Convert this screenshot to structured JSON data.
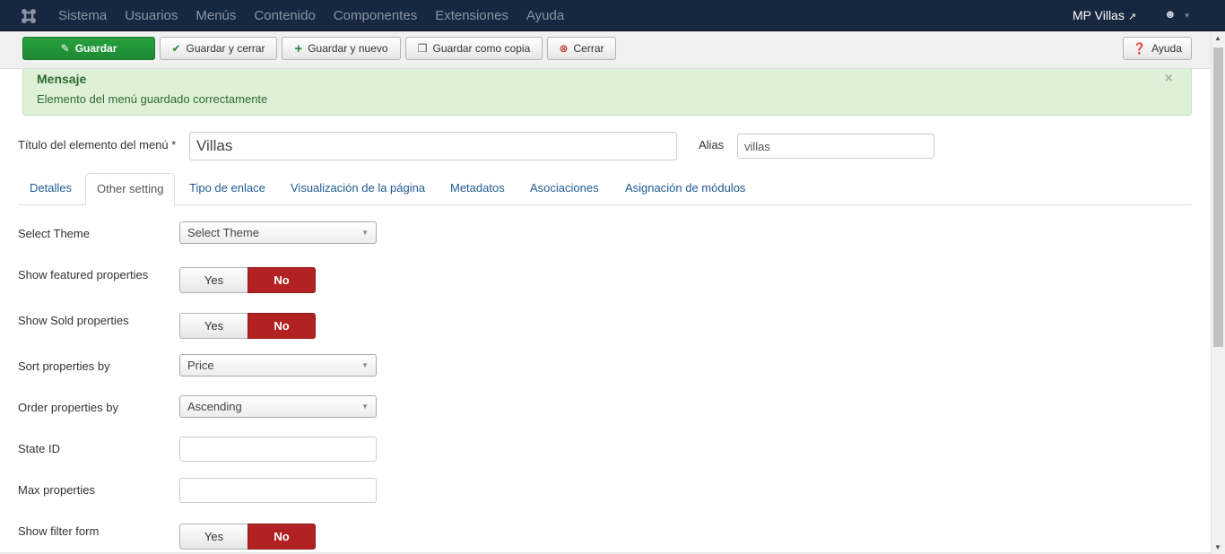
{
  "navbar": {
    "menu": [
      "Sistema",
      "Usuarios",
      "Menús",
      "Contenido",
      "Componentes",
      "Extensiones",
      "Ayuda"
    ],
    "site_name": "MP Villas",
    "site_icon": "external-link-icon",
    "user_icon": "user-icon"
  },
  "toolbar": {
    "save": "Guardar",
    "save_close": "Guardar y cerrar",
    "save_new": "Guardar y nuevo",
    "save_copy": "Guardar como copia",
    "close": "Cerrar",
    "help": "Ayuda"
  },
  "message": {
    "heading": "Mensaje",
    "text": "Elemento del menú guardado correctamente",
    "close": "×"
  },
  "title_field": {
    "label": "Título del elemento del menú *",
    "value": "Villas"
  },
  "alias_field": {
    "label": "Alias",
    "value": "villas"
  },
  "tabs": [
    "Detalles",
    "Other setting",
    "Tipo de enlace",
    "Visualización de la página",
    "Metadatos",
    "Asociaciones",
    "Asignación de módulos"
  ],
  "active_tab": "Other setting",
  "form": {
    "select_theme": {
      "label": "Select Theme",
      "value": "Select Theme"
    },
    "show_featured": {
      "label": "Show featured properties",
      "yes": "Yes",
      "no": "No",
      "selected": "No"
    },
    "show_sold": {
      "label": "Show Sold properties",
      "yes": "Yes",
      "no": "No",
      "selected": "No"
    },
    "sort_by": {
      "label": "Sort properties by",
      "value": "Price"
    },
    "order_by": {
      "label": "Order properties by",
      "value": "Ascending"
    },
    "state_id": {
      "label": "State ID",
      "value": ""
    },
    "max_properties": {
      "label": "Max properties",
      "value": ""
    },
    "show_filter": {
      "label": "Show filter form",
      "yes": "Yes",
      "no": "No",
      "selected": "No"
    }
  },
  "colors": {
    "navbar": "#17273f",
    "save_button": "#1e8a33",
    "toggle_no": "#b32222",
    "alert_bg": "#dff0d8",
    "link": "#1f5a93"
  }
}
